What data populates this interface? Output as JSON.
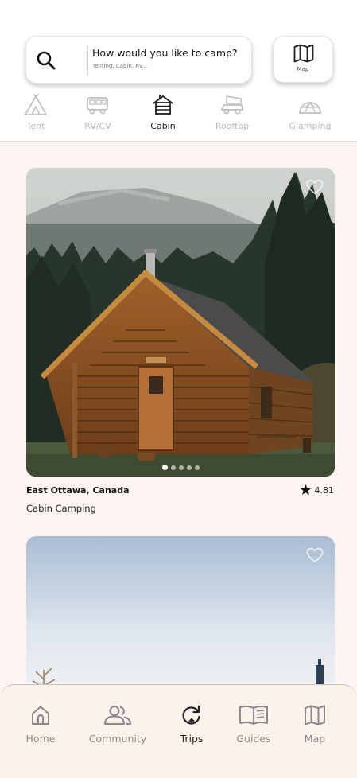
{
  "search": {
    "prompt": "How would you like to camp?",
    "hint": "Tenting, Cabin, RV...",
    "icon": "search-icon"
  },
  "map_button": {
    "label": "Map",
    "icon": "map-icon"
  },
  "categories": [
    {
      "label": "Tent",
      "icon": "tent-icon",
      "active": false
    },
    {
      "label": "RV/CV",
      "icon": "rv-icon",
      "active": false
    },
    {
      "label": "Cabin",
      "icon": "cabin-icon",
      "active": true
    },
    {
      "label": "Rooftop",
      "icon": "rooftop-tent-icon",
      "active": false
    },
    {
      "label": "Glamping",
      "icon": "dome-icon",
      "active": false
    }
  ],
  "listings": [
    {
      "location": "East Ottawa, Canada",
      "type": "Cabin Camping",
      "rating": "4.81",
      "carousel": {
        "count": 5,
        "active_index": 0
      }
    },
    {}
  ],
  "nav": [
    {
      "label": "Home",
      "icon": "home-icon",
      "active": false
    },
    {
      "label": "Community",
      "icon": "community-icon",
      "active": false
    },
    {
      "label": "Trips",
      "icon": "trips-icon",
      "active": true
    },
    {
      "label": "Guides",
      "icon": "book-icon",
      "active": false
    },
    {
      "label": "Map",
      "icon": "map-icon",
      "active": false
    }
  ],
  "colors": {
    "accent_bg": "#fdf5f1",
    "nav_bg": "#fdf1eb",
    "inactive_text": "#b9b9b9",
    "active_text": "#222222"
  }
}
